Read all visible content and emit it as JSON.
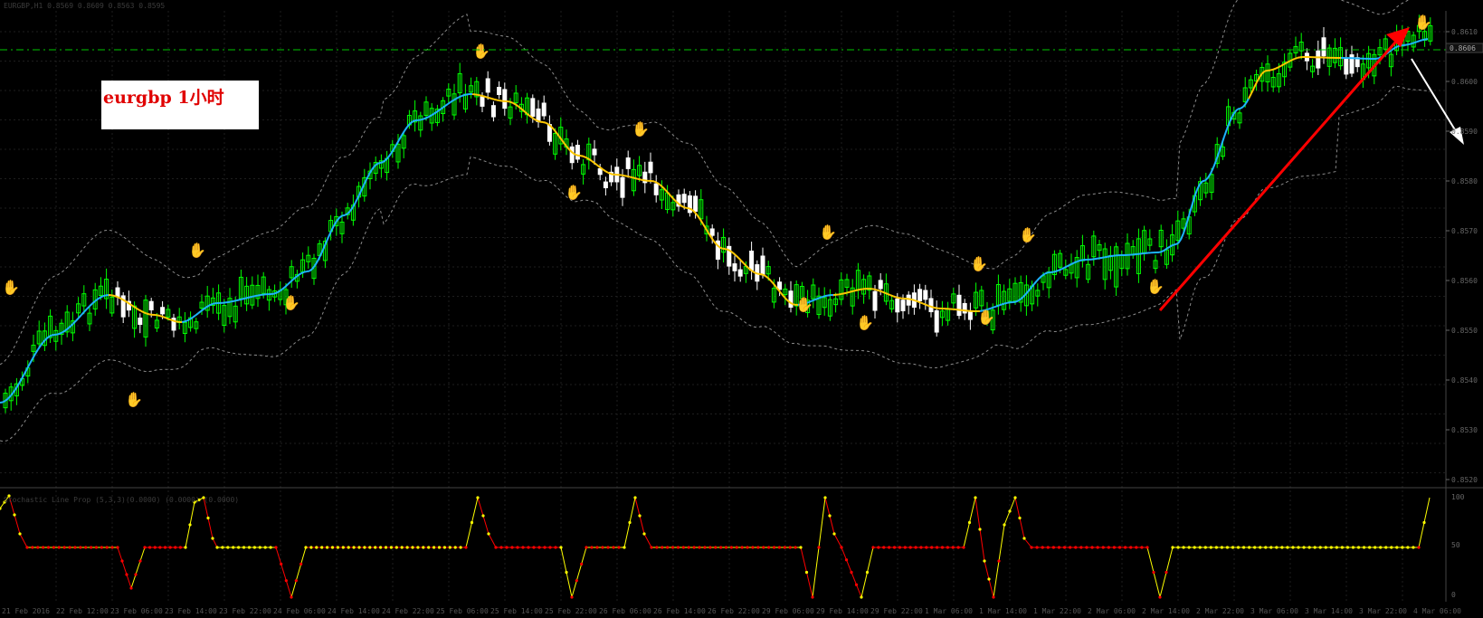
{
  "chart_data": {
    "type": "candlestick",
    "symbol_label": "eurgbp 1小时",
    "header_text": "EURGBP,H1  0.8569 0.8609 0.8563 0.8595",
    "sub_header_text": "Stochastic Line Prop (5,3,3)(0.0000) (0.0000) (0.0000)",
    "price_axis": {
      "min": 0.852,
      "max": 0.862,
      "ticks": [
        "0.8610",
        "0.8600",
        "0.8590",
        "0.8580",
        "0.8570",
        "0.8560",
        "0.8550",
        "0.8540",
        "0.8530",
        "0.8520"
      ],
      "current_price": "0.8606"
    },
    "time_axis": {
      "ticks": [
        "21 Feb 2016",
        "22 Feb 12:00",
        "23 Feb 06:00",
        "23 Feb 14:00",
        "23 Feb 22:00",
        "24 Feb 06:00",
        "24 Feb 14:00",
        "24 Feb 22:00",
        "25 Feb 06:00",
        "25 Feb 14:00",
        "25 Feb 22:00",
        "26 Feb 06:00",
        "26 Feb 14:00",
        "26 Feb 22:00",
        "29 Feb 06:00",
        "29 Feb 14:00",
        "29 Feb 22:00",
        "1 Mar 06:00",
        "1 Mar 14:00",
        "1 Mar 22:00",
        "2 Mar 06:00",
        "2 Mar 14:00",
        "2 Mar 22:00",
        "3 Mar 06:00",
        "3 Mar 14:00",
        "3 Mar 22:00",
        "4 Mar 06:00"
      ]
    },
    "colors": {
      "background": "#000000",
      "bull_candle": "#00ff00",
      "bear_candle": "#ffffff",
      "ma_up": "#1eb4ff",
      "ma_down": "#ffc800",
      "bands": "#8c8c8c",
      "resistance_line": "#00c800",
      "trend_arrow": "#ff0000",
      "projection_arrow": "#ffffff",
      "osc_high": "#ff0000",
      "osc_low": "#ffff00",
      "sell_hand": "#ff2020",
      "buy_hand": "#3c8cff"
    },
    "indicator_axis": {
      "ticks": [
        "100",
        "50",
        "0"
      ]
    }
  }
}
